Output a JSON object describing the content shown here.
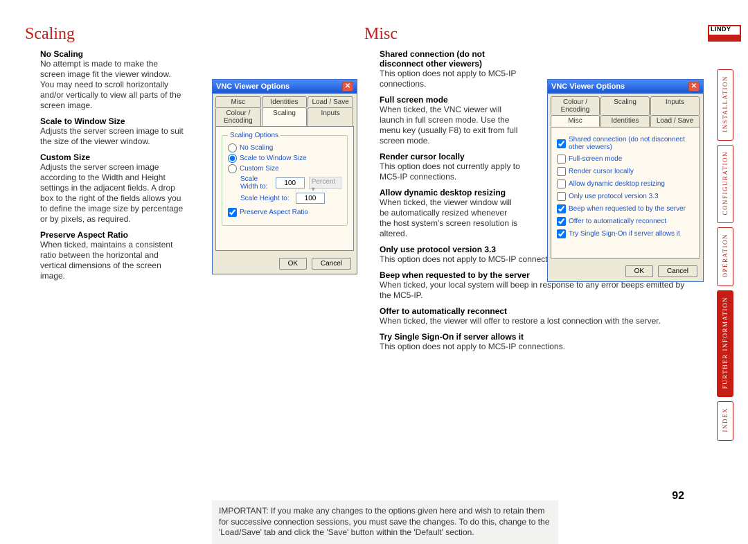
{
  "headings": {
    "scaling": "Scaling",
    "misc": "Misc"
  },
  "scaling_items": [
    {
      "title": "No Scaling",
      "desc": "No attempt is made to make the screen image fit the viewer window. You may need to scroll horizontally and/or vertically to view all parts of the screen image."
    },
    {
      "title": "Scale to Window Size",
      "desc": "Adjusts the server screen image to suit the size of the viewer window."
    },
    {
      "title": "Custom Size",
      "desc": "Adjusts the server screen image according to the Width and Height settings in the adjacent fields. A drop box to the right of the fields allows you to define the image size by percentage or by pixels, as required."
    },
    {
      "title": "Preserve Aspect Ratio",
      "desc": "When ticked, maintains a consistent ratio between the horizontal and vertical dimensions of the screen image."
    }
  ],
  "misc_items_narrow": [
    {
      "title": "Shared connection (do not disconnect other viewers)",
      "desc": "This option does not apply to MC5-IP connections."
    },
    {
      "title": "Full screen mode",
      "desc": "When ticked, the VNC viewer will launch in full screen mode. Use the menu key (usually F8) to exit from full screen mode."
    },
    {
      "title": "Render cursor locally",
      "desc": "This option does not currently apply to MC5-IP connections."
    },
    {
      "title": "Allow dynamic desktop resizing",
      "desc": "When ticked, the viewer window will be automatically resized whenever the host system's screen resolution is altered."
    }
  ],
  "misc_items_wide": [
    {
      "title": "Only use protocol version 3.3",
      "desc": "This option does not apply to MC5-IP connections."
    },
    {
      "title": "Beep when requested to by the server",
      "desc": "When ticked, your local system will beep in response to any error beeps emitted by the MC5-IP."
    },
    {
      "title": "Offer to automatically reconnect",
      "desc": "When ticked, the viewer will offer to restore a lost connection with the server."
    },
    {
      "title": "Try Single Sign-On if server allows it",
      "desc": "This option does not apply to MC5-IP connections."
    }
  ],
  "dialog": {
    "title": "VNC Viewer Options",
    "tabs_row1": [
      "Misc",
      "Identities",
      "Load / Save"
    ],
    "tabs_row2": [
      "Colour / Encoding",
      "Scaling",
      "Inputs"
    ],
    "misc_tabs_row1": [
      "Colour / Encoding",
      "Scaling",
      "Inputs"
    ],
    "misc_tabs_row2": [
      "Misc",
      "Identities",
      "Load / Save"
    ],
    "scaling_group_title": "Scaling Options",
    "radios": {
      "no_scaling": "No Scaling",
      "to_window": "Scale to Window Size",
      "custom": "Custom Size"
    },
    "fields": {
      "width_label": "Scale Width to:",
      "width_val": "100",
      "height_label": "Scale Height to:",
      "height_val": "100",
      "unit": "Percent"
    },
    "preserve": "Preserve Aspect Ratio",
    "misc_checks": [
      {
        "label": "Shared connection (do not disconnect other viewers)",
        "checked": true
      },
      {
        "label": "Full-screen mode",
        "checked": false
      },
      {
        "label": "Render cursor locally",
        "checked": false
      },
      {
        "label": "Allow dynamic desktop resizing",
        "checked": false
      },
      {
        "label": "Only use protocol version 3.3",
        "checked": false
      },
      {
        "label": "Beep when requested to by the server",
        "checked": true
      },
      {
        "label": "Offer to automatically reconnect",
        "checked": true
      },
      {
        "label": "Try Single Sign-On if server allows it",
        "checked": true
      }
    ],
    "ok": "OK",
    "cancel": "Cancel"
  },
  "note": "IMPORTANT: If you make any changes to the options given here and wish to retain them for successive connection sessions, you must save the changes. To do this, change to the 'Load/Save' tab and click the 'Save' button within the 'Default' section.",
  "page_number": "92",
  "logo": "LINDY",
  "nav": [
    "INSTALLATION",
    "CONFIGURATION",
    "OPERATION",
    "FURTHER INFORMATION",
    "INDEX"
  ],
  "nav_active": 3
}
